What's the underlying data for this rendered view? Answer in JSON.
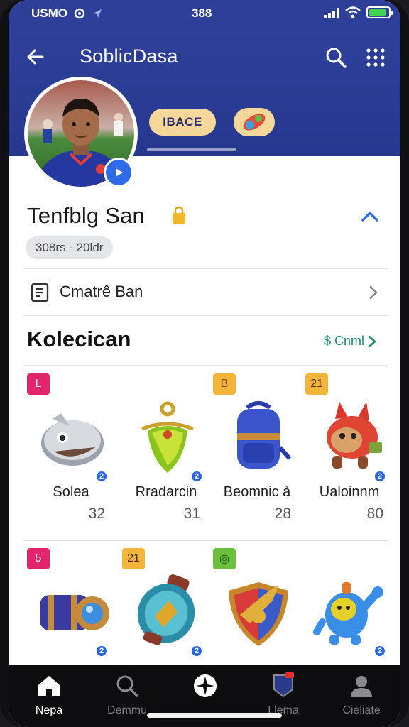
{
  "status_bar": {
    "carrier": "USMO",
    "time": "388"
  },
  "header": {
    "title": "SoblicDasa",
    "chip_label": "IBACE"
  },
  "profile": {
    "name": "Tenfblg San",
    "meta": "308rs - 20ldr"
  },
  "action_row": {
    "label": "Cmatrê Ban"
  },
  "collection": {
    "title": "Kolecican",
    "link_label": "$ Cnml",
    "items": [
      {
        "tag": "L",
        "tag_color": "#e0256b",
        "tag_text_color": "#ffffff",
        "name": "Solea",
        "count": "32",
        "art": "whale-figure"
      },
      {
        "tag": "",
        "tag_color": "#ffffff",
        "tag_text_color": "#222222",
        "name": "Rradarcin",
        "count": "31",
        "art": "green-amulet"
      },
      {
        "tag": "B",
        "tag_color": "#f3b43a",
        "tag_text_color": "#7a4a00",
        "name": "Beomnic à",
        "count": "28",
        "art": "blue-backpack"
      },
      {
        "tag": "21",
        "tag_color": "#f3b43a",
        "tag_text_color": "#4a2f00",
        "name": "Ualoinnm",
        "count": "80",
        "art": "red-creature"
      },
      {
        "tag": "5",
        "tag_color": "#e0256b",
        "tag_text_color": "#ffffff",
        "name": "",
        "count": "",
        "art": "barrel-cannon"
      },
      {
        "tag": "21",
        "tag_color": "#f3b43a",
        "tag_text_color": "#4a2f00",
        "name": "",
        "count": "",
        "art": "teal-capsule"
      },
      {
        "tag": "◎",
        "tag_color": "#6cbf3a",
        "tag_text_color": "#1c4a00",
        "name": "",
        "count": "",
        "art": "shield-emblem"
      },
      {
        "tag": "",
        "tag_color": "#ffffff",
        "tag_text_color": "#222222",
        "name": "",
        "count": "",
        "art": "blue-robot"
      }
    ]
  },
  "bottom_nav": {
    "items": [
      {
        "label": "Nepa",
        "icon": "home-icon",
        "active": true
      },
      {
        "label": "Demmu",
        "icon": "search-icon",
        "active": false
      },
      {
        "label": "",
        "icon": "compass-icon",
        "active": false
      },
      {
        "label": "Llema",
        "icon": "badge-icon",
        "active": false
      },
      {
        "label": "Cieliate",
        "icon": "profile-icon",
        "active": false
      }
    ]
  },
  "colors": {
    "header_bg": "#2f409b",
    "accent_blue": "#2f6be8",
    "link_green": "#1a8b6b",
    "tag_pink": "#e0256b",
    "tag_yellow": "#f3b43a"
  }
}
